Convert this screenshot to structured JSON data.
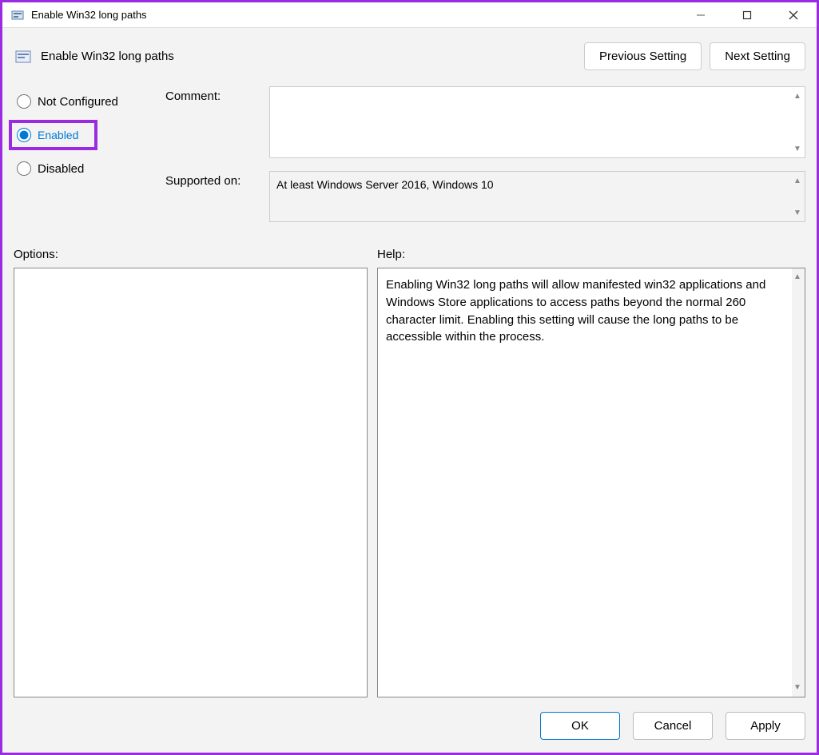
{
  "window": {
    "title": "Enable Win32 long paths"
  },
  "policy": {
    "title": "Enable Win32 long paths"
  },
  "nav": {
    "prev_label": "Previous Setting",
    "next_label": "Next Setting"
  },
  "radios": {
    "not_configured": "Not Configured",
    "enabled": "Enabled",
    "disabled": "Disabled",
    "selected": "enabled"
  },
  "fields": {
    "comment_label": "Comment:",
    "comment_value": "",
    "supported_label": "Supported on:",
    "supported_value": "At least Windows Server 2016, Windows 10"
  },
  "midlabels": {
    "options": "Options:",
    "help": "Help:"
  },
  "help": {
    "text": "Enabling Win32 long paths will allow manifested win32 applications and Windows Store applications to access paths beyond the normal 260 character limit.  Enabling this setting will cause the long paths to be accessible within the process."
  },
  "footer": {
    "ok": "OK",
    "cancel": "Cancel",
    "apply": "Apply"
  }
}
